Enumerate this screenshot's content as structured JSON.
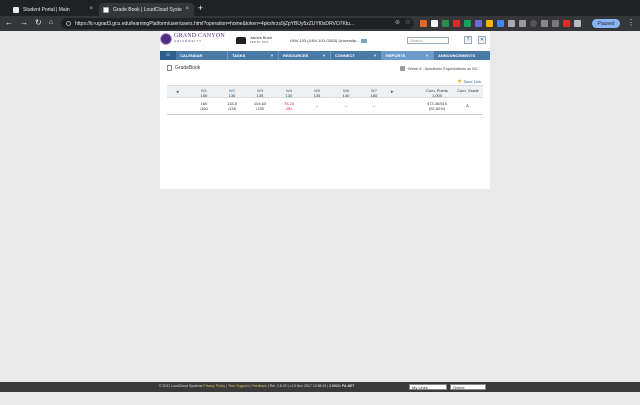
{
  "browser": {
    "tabs": [
      {
        "title": "Student Portal | Main"
      },
      {
        "title": "Grade Book | LoudCloud Syste"
      }
    ],
    "url": "https://lc-ugrad3.gcu.edu/learningPlatform/user/users.html?operation=home&token=4pkxhrzs9jZpYBUy5zZUYf0sDRVO7Ktu...",
    "profile_label": "Paused"
  },
  "header": {
    "logo_line1": "GRAND CANYON",
    "logo_line2": "UNIVERSITY",
    "user_name": "James Bush",
    "user_date": "FEB 25, 2019",
    "course": "UNV-103 (UNV-103-O503) University...",
    "search_placeholder": "Search"
  },
  "nav": {
    "items": [
      "CALENDAR",
      "TASKS",
      "RESOURCES",
      "CONNECT",
      "REPORTS",
      "ANNOUNCEMENTS"
    ]
  },
  "gradebook": {
    "title": "GradeBook",
    "week_info": "Week 5 : Academic Expectations at GC",
    "save_link": "Save Link",
    "headers": [
      {
        "week": "W1",
        "points": "160"
      },
      {
        "week": "W2",
        "points": "135"
      },
      {
        "week": "W3",
        "points": "135"
      },
      {
        "week": "W4",
        "points": "130"
      },
      {
        "week": "W5",
        "points": "135"
      },
      {
        "week": "W6",
        "points": "140"
      },
      {
        "week": "W7",
        "points": "160"
      }
    ],
    "cum_points_label": "Cum. Points",
    "cum_points_total": "1,000",
    "cum_grade_label": "Cum. Grade",
    "scores": [
      {
        "score": "160",
        "of": "/160"
      },
      {
        "score": "133.5",
        "of": "/135"
      },
      {
        "score": "104.63",
        "of": "/135"
      },
      {
        "score": "75.23",
        "of": "/80"
      },
      {
        "score": "--",
        "of": ""
      },
      {
        "score": "--",
        "of": ""
      },
      {
        "score": "--",
        "of": ""
      }
    ],
    "cum_points_value": "473.36/510",
    "cum_points_pct": "(92.82%)",
    "cum_grade_value": "A-"
  },
  "footer": {
    "copyright": "© 2011 LoudCloud Systems",
    "links": [
      "Privacy Policy",
      "Tech Support",
      "Feedback"
    ],
    "build": "Rel. 2.8.29 | v.13 Nov 2017 13:58:29 |",
    "server": "2.00/21 PA-NET",
    "my_links": "My Links",
    "status": "Online"
  },
  "colors": {
    "nav_blue": "#4a7aa8",
    "brand_purple": "#522d80",
    "low_score_red": "#d02020"
  }
}
